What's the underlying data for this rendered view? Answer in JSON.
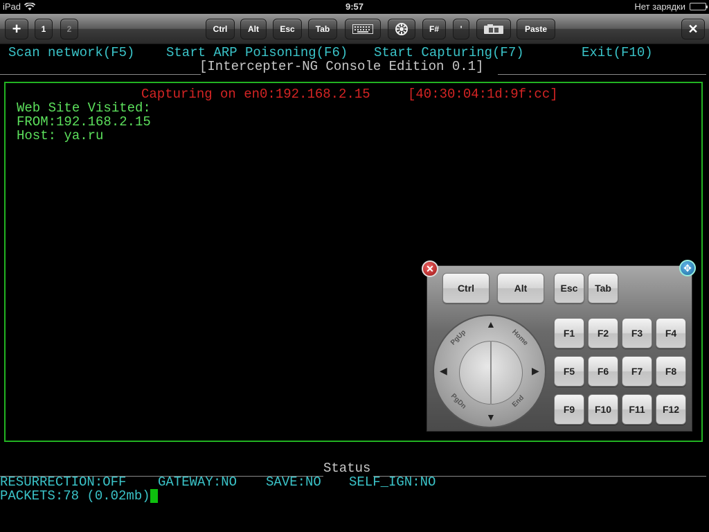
{
  "statusbar": {
    "device": "iPad",
    "time": "9:57",
    "battery_text": "Нет зарядки"
  },
  "toolbar": {
    "plus": "+",
    "tab1": "1",
    "tab2": "2",
    "ctrl": "Ctrl",
    "alt": "Alt",
    "esc": "Esc",
    "tab": "Tab",
    "fkey": "F#",
    "quote": "'",
    "paste": "Paste",
    "close": "✕"
  },
  "menu": {
    "scan_label": "Scan network",
    "scan_key": "(F5)",
    "arp_label": "Start ARP Poisoning",
    "arp_key": "(F6)",
    "capture_label": "Start Capturing",
    "capture_key": "(F7)",
    "exit_label": "Exit",
    "exit_key": "(F10)"
  },
  "title_bar": {
    "left_rule": "_______________________________",
    "title": "[Intercepter-NG Console Edition 0.1]",
    "right_rule": "___________"
  },
  "capture": {
    "status": "Capturing on en0:192.168.2.15",
    "mac": "[40:30:04:1d:9f:cc]",
    "lines": [
      "Web Site Visited:",
      "FROM:192.168.2.15",
      "Host: ya.ru"
    ]
  },
  "keypad": {
    "close": "✕",
    "move": "✥",
    "ctrl": "Ctrl",
    "alt": "Alt",
    "esc": "Esc",
    "tab": "Tab",
    "fkeys": [
      "F1",
      "F2",
      "F3",
      "F4",
      "F5",
      "F6",
      "F7",
      "F8",
      "F9",
      "F10",
      "F11",
      "F12"
    ],
    "dpad": {
      "pgup": "PgUp",
      "home": "Home",
      "pgdn": "PgDn",
      "end": "End",
      "up": "▲",
      "down": "▼",
      "left": "◀",
      "right": "▶"
    }
  },
  "status_panel": {
    "title": "Status",
    "resurrection": "RESURRECTION:OFF",
    "gateway": "GATEWAY:NO",
    "save": "SAVE:NO",
    "self_ign": "SELF_IGN:NO",
    "packets": "PACKETS:78 (0.02mb)"
  },
  "colors": {
    "menu_cyan": "#3ac3c8",
    "text_green": "#5ce05c",
    "capture_red": "#d42424",
    "border_green": "#22b322",
    "cursor_green": "#0ec00e"
  },
  "icons": {
    "wifi": "wifi-icon",
    "battery": "battery-icon",
    "keyboard": "keyboard-icon",
    "settings": "settings-icon",
    "camera": "camera-icon"
  }
}
